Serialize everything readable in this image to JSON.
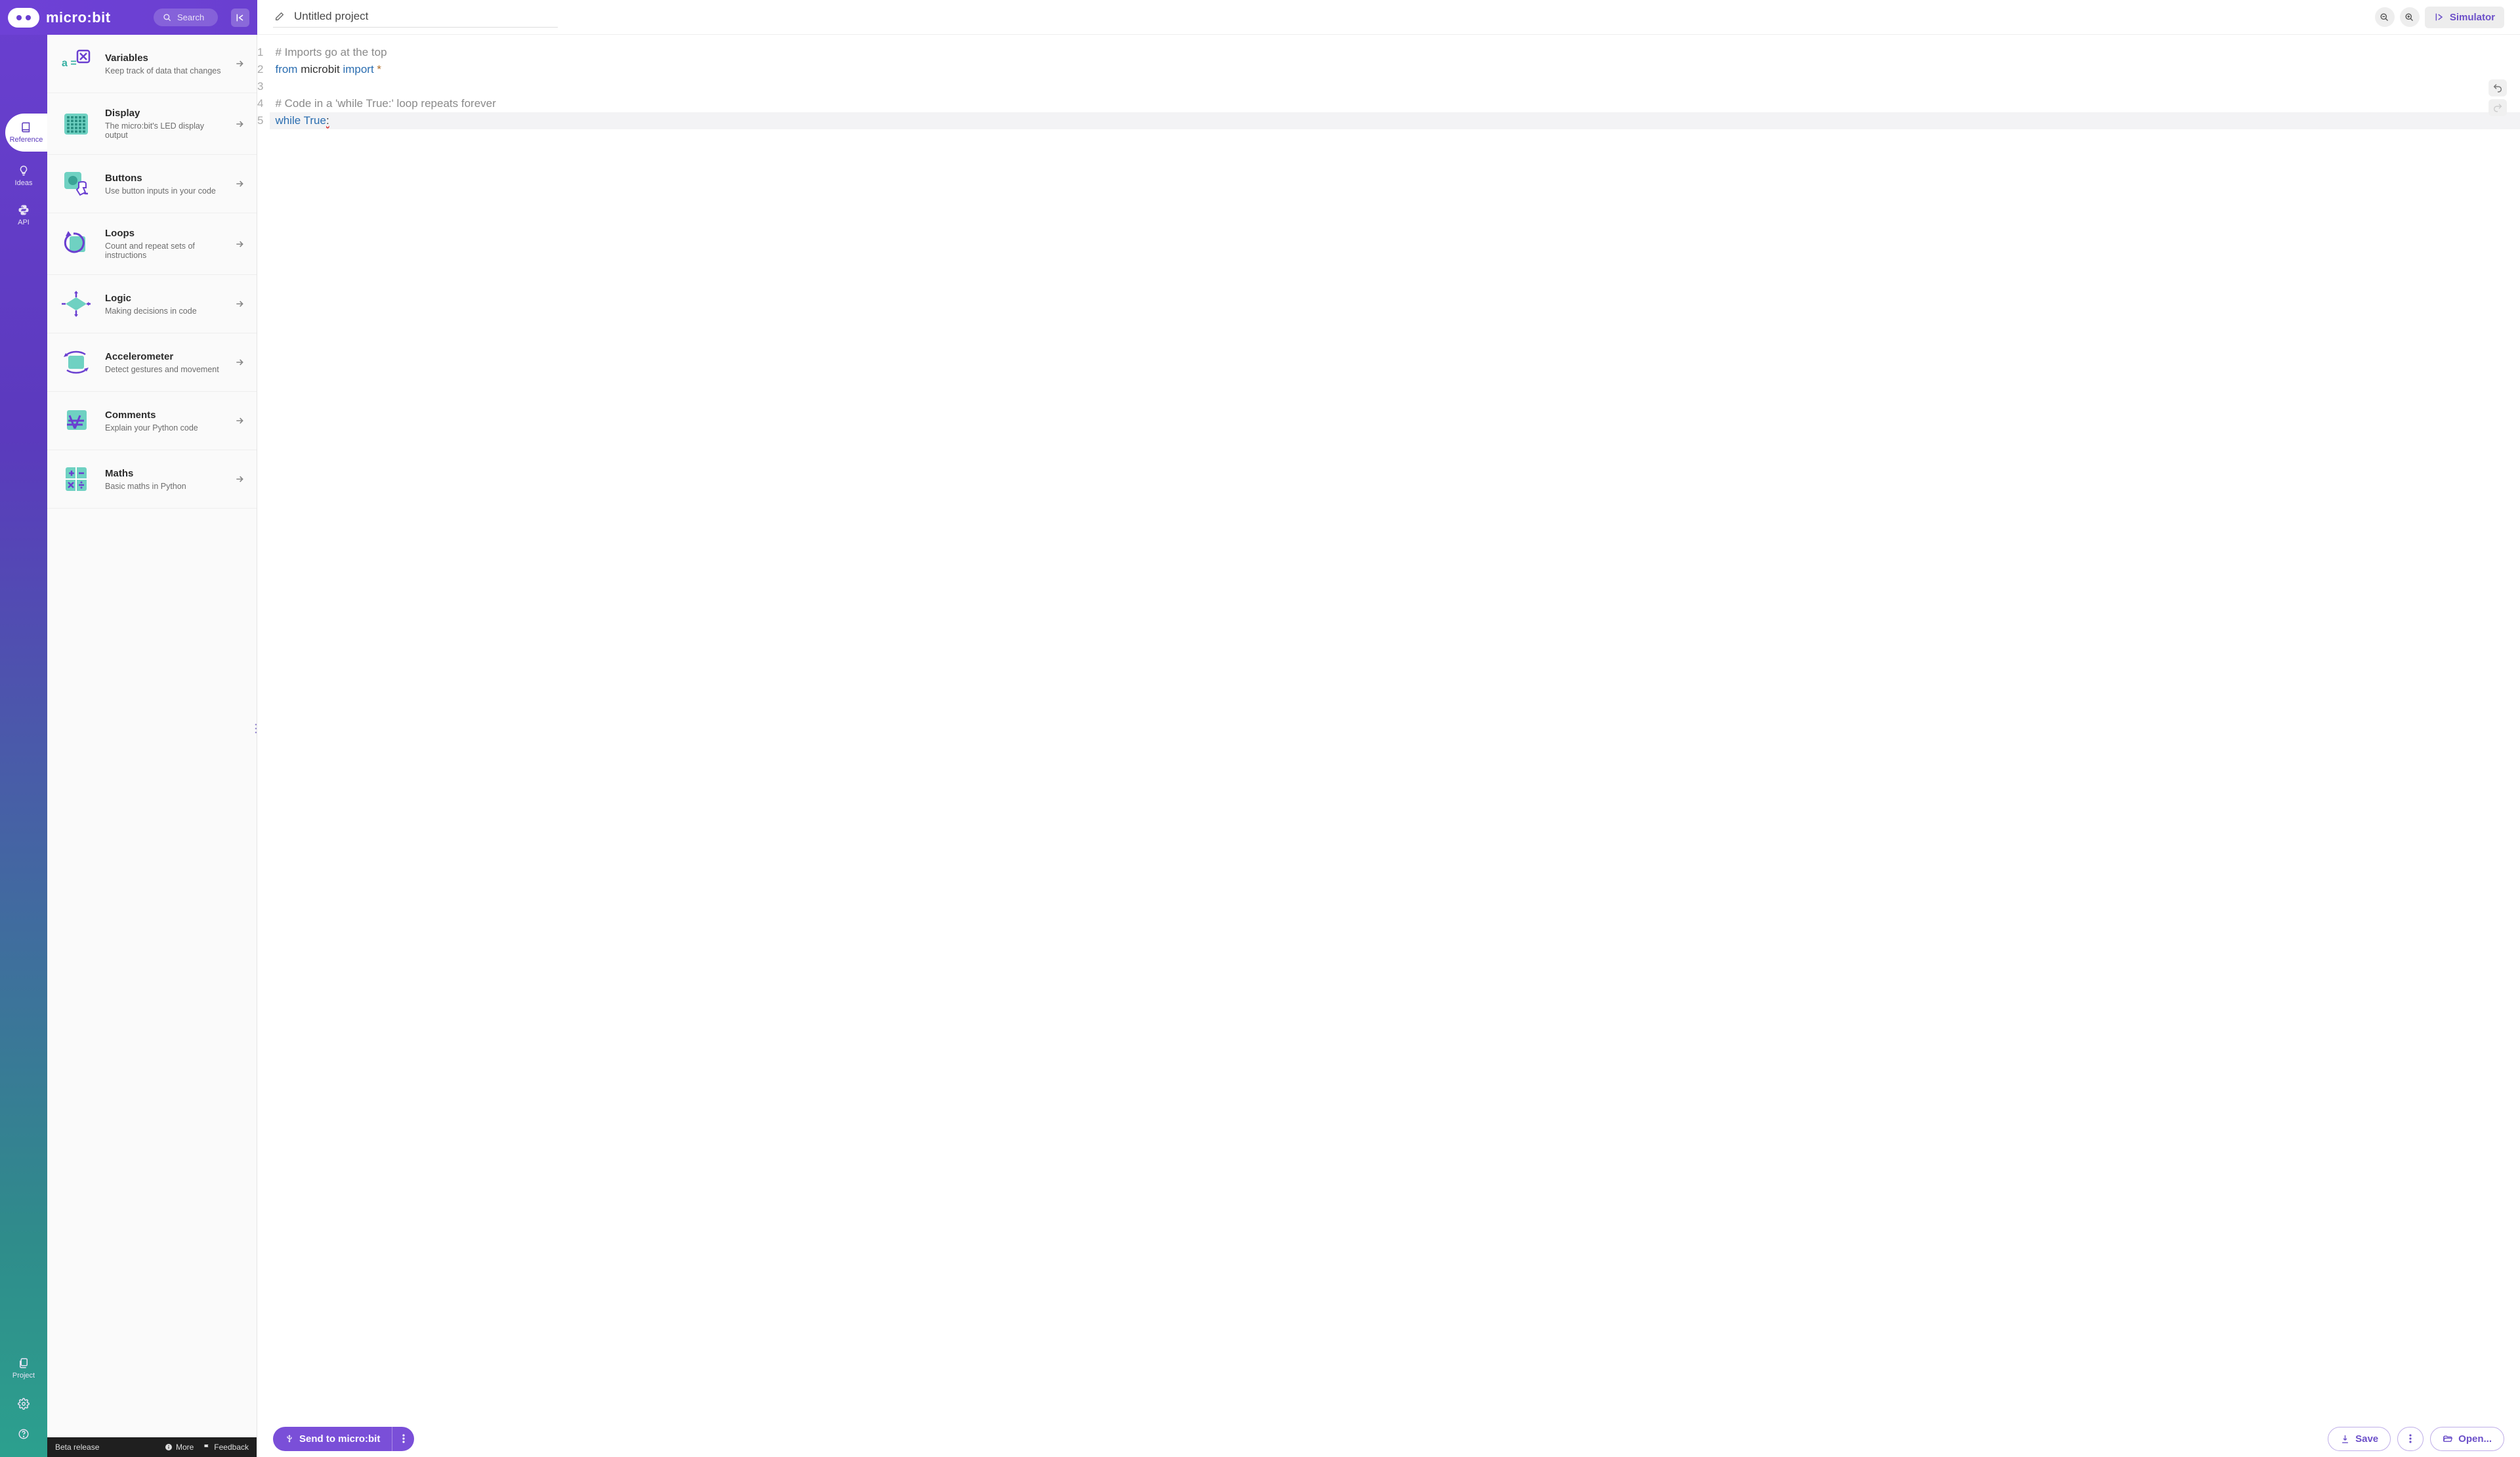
{
  "brand": {
    "name": "micro:bit",
    "search_placeholder": "Search"
  },
  "rail": {
    "tabs": [
      {
        "id": "reference",
        "label": "Reference"
      },
      {
        "id": "ideas",
        "label": "Ideas"
      },
      {
        "id": "api",
        "label": "API"
      }
    ],
    "project_label": "Project"
  },
  "reference_items": [
    {
      "title": "Variables",
      "desc": "Keep track of data that changes"
    },
    {
      "title": "Display",
      "desc": "The micro:bit's LED display output"
    },
    {
      "title": "Buttons",
      "desc": "Use button inputs in your code"
    },
    {
      "title": "Loops",
      "desc": "Count and repeat sets of instructions"
    },
    {
      "title": "Logic",
      "desc": "Making decisions in code"
    },
    {
      "title": "Accelerometer",
      "desc": "Detect gestures and movement"
    },
    {
      "title": "Comments",
      "desc": "Explain your Python code"
    },
    {
      "title": "Maths",
      "desc": "Basic maths in Python"
    }
  ],
  "sidebar_footer": {
    "beta": "Beta release",
    "more": "More",
    "feedback": "Feedback"
  },
  "editor": {
    "project_title": "Untitled project",
    "simulator_label": "Simulator",
    "lines": [
      {
        "n": 1,
        "tokens": [
          {
            "t": "# Imports go at the top",
            "c": "comment"
          }
        ]
      },
      {
        "n": 2,
        "tokens": [
          {
            "t": "from",
            "c": "kw"
          },
          {
            "t": " microbit ",
            "c": "id"
          },
          {
            "t": "import",
            "c": "kw"
          },
          {
            "t": " *",
            "c": "op"
          }
        ]
      },
      {
        "n": 3,
        "tokens": []
      },
      {
        "n": 4,
        "tokens": [
          {
            "t": "# Code in a 'while True:' loop repeats forever",
            "c": "comment"
          }
        ]
      },
      {
        "n": 5,
        "error": true,
        "active": true,
        "tokens": [
          {
            "t": "while",
            "c": "kw"
          },
          {
            "t": " ",
            "c": "id"
          },
          {
            "t": "True",
            "c": "kw"
          },
          {
            "t": ":",
            "c": "err"
          }
        ]
      }
    ]
  },
  "bottom": {
    "send_label": "Send to micro:bit",
    "save_label": "Save",
    "open_label": "Open..."
  }
}
